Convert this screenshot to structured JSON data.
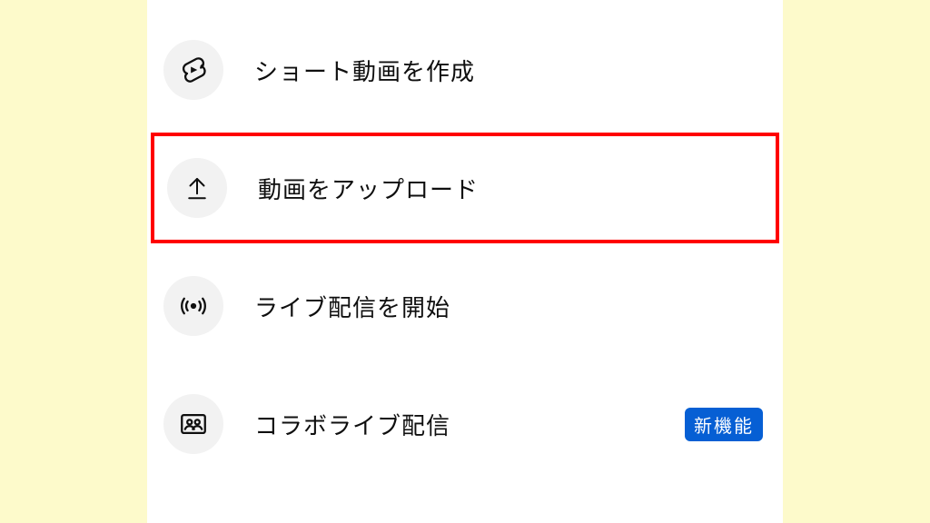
{
  "menu": {
    "items": [
      {
        "label": "ショート動画を作成",
        "highlighted": false,
        "badge": null
      },
      {
        "label": "動画をアップロード",
        "highlighted": true,
        "badge": null
      },
      {
        "label": "ライブ配信を開始",
        "highlighted": false,
        "badge": null
      },
      {
        "label": "コラボライブ配信",
        "highlighted": false,
        "badge": "新機能"
      }
    ]
  },
  "colors": {
    "highlight": "#ff0000",
    "badge_bg": "#065fd4"
  }
}
